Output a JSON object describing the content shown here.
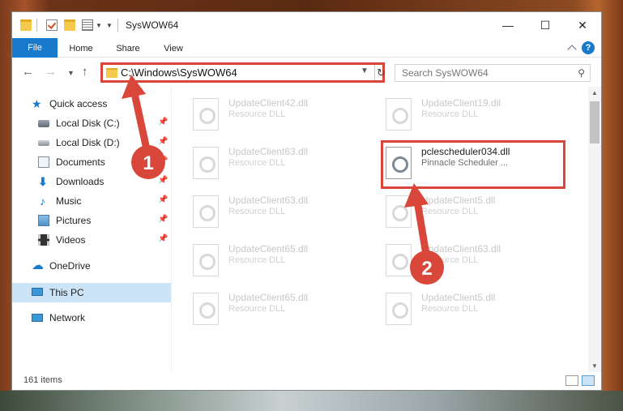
{
  "window": {
    "title": "SysWOW64",
    "minimize": "—",
    "maximize": "☐",
    "close": "✕"
  },
  "ribbon": {
    "tabs": [
      "File",
      "Home",
      "Share",
      "View"
    ],
    "help": "?"
  },
  "address": {
    "path": "C:\\Windows\\SysWOW64",
    "search_placeholder": "Search SysWOW64"
  },
  "nav": {
    "quick_access": "Quick access",
    "items": [
      {
        "label": "Local Disk (C:)",
        "icon": "drive-icon",
        "pinned": true
      },
      {
        "label": "Local Disk (D:)",
        "icon": "drive-icon",
        "pinned": true
      },
      {
        "label": "Documents",
        "icon": "documents-icon",
        "pinned": true
      },
      {
        "label": "Downloads",
        "icon": "downloads-icon",
        "pinned": true
      },
      {
        "label": "Music",
        "icon": "music-icon",
        "pinned": true
      },
      {
        "label": "Pictures",
        "icon": "pictures-icon",
        "pinned": true
      },
      {
        "label": "Videos",
        "icon": "videos-icon",
        "pinned": true
      }
    ],
    "onedrive": "OneDrive",
    "this_pc": "This PC",
    "network": "Network"
  },
  "files": [
    {
      "name": "UpdateClient42.dll",
      "desc": "Resource DLL"
    },
    {
      "name": "UpdateClient19.dll",
      "desc": "Resource DLL"
    },
    {
      "name": "UpdateClient63.dll",
      "desc": "Resource DLL"
    },
    {
      "name": "pclescheduler034.dll",
      "desc": "Pinnacle Scheduler ...",
      "highlighted": true
    },
    {
      "name": "UpdateClient63.dll",
      "desc": "Resource DLL"
    },
    {
      "name": "UpdateClient5.dll",
      "desc": "Resource DLL"
    },
    {
      "name": "UpdateClient65.dll",
      "desc": "Resource DLL"
    },
    {
      "name": "UpdateClient63.dll",
      "desc": "Resource DLL"
    },
    {
      "name": "UpdateClient65.dll",
      "desc": "Resource DLL"
    },
    {
      "name": "UpdateClient5.dll",
      "desc": "Resource DLL"
    }
  ],
  "status": {
    "count": "161 items"
  },
  "annotations": {
    "step1": "1",
    "step2": "2",
    "color": "#d9463a"
  }
}
